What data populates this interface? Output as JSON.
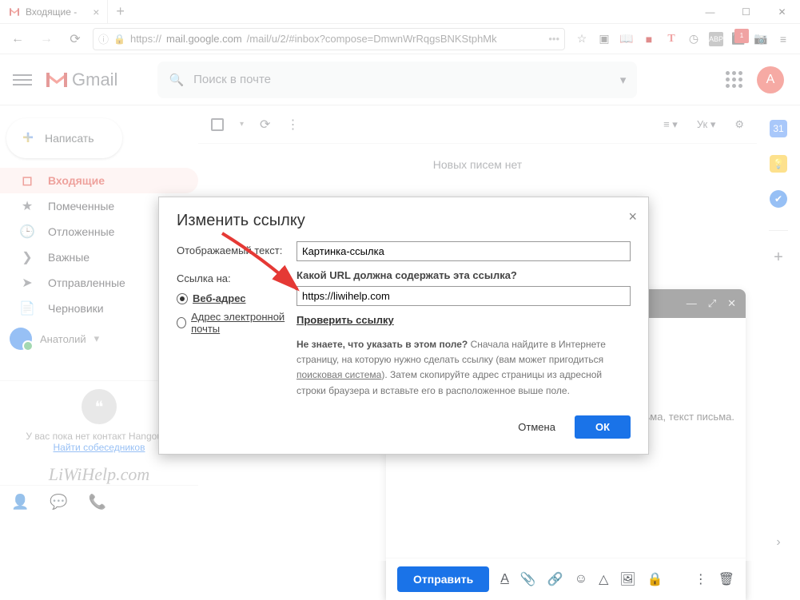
{
  "browser": {
    "tab_title": "Входящие -",
    "url_prefix": "https://",
    "url_host": "mail.google.com",
    "url_path": "/mail/u/2/#inbox?compose=DmwnWrRqgsBNKStphMk"
  },
  "gmail": {
    "logo_text": "Gmail",
    "search_placeholder": "Поиск в почте",
    "compose": "Написать",
    "avatar_letter": "А",
    "folders": [
      {
        "icon": "inbox",
        "label": "Входящие",
        "active": true
      },
      {
        "icon": "star",
        "label": "Помеченные"
      },
      {
        "icon": "clock",
        "label": "Отложенные"
      },
      {
        "icon": "importance",
        "label": "Важные"
      },
      {
        "icon": "sent",
        "label": "Отправленные"
      },
      {
        "icon": "draft",
        "label": "Черновики"
      }
    ],
    "user_name": "Анатолий",
    "hangouts_empty": "У вас пока нет контакт Hangouts.",
    "hangouts_link": "Найти собеседников",
    "watermark": "LiWiHelp.com",
    "toolbar_lang": "Ук",
    "no_new": "Новых писем нет",
    "body_text": "текст письма, текст письма, текст письма.",
    "compose_send": "Отправить"
  },
  "modal": {
    "title": "Изменить ссылку",
    "display_text_label": "Отображаемый текст:",
    "display_text_value": "Картинка-ссылка",
    "link_to_label": "Ссылка на:",
    "radio_web": "Веб-адрес",
    "radio_email": "Адрес электронной почты",
    "url_question": "Какой URL должна содержать эта ссылка?",
    "url_value": "https://liwihelp.com",
    "test_link": "Проверить ссылку",
    "hint_bold": "Не знаете, что указать в этом поле?",
    "hint_rest1": " Сначала найдите в Интернете страницу, на которую нужно сделать ссылку (вам может пригодиться ",
    "hint_link": "поисковая система",
    "hint_rest2": "). Затем скопируйте адрес страницы из адресной строки браузера и вставьте его в расположенное выше поле.",
    "cancel": "Отмена",
    "ok": "ОК"
  }
}
